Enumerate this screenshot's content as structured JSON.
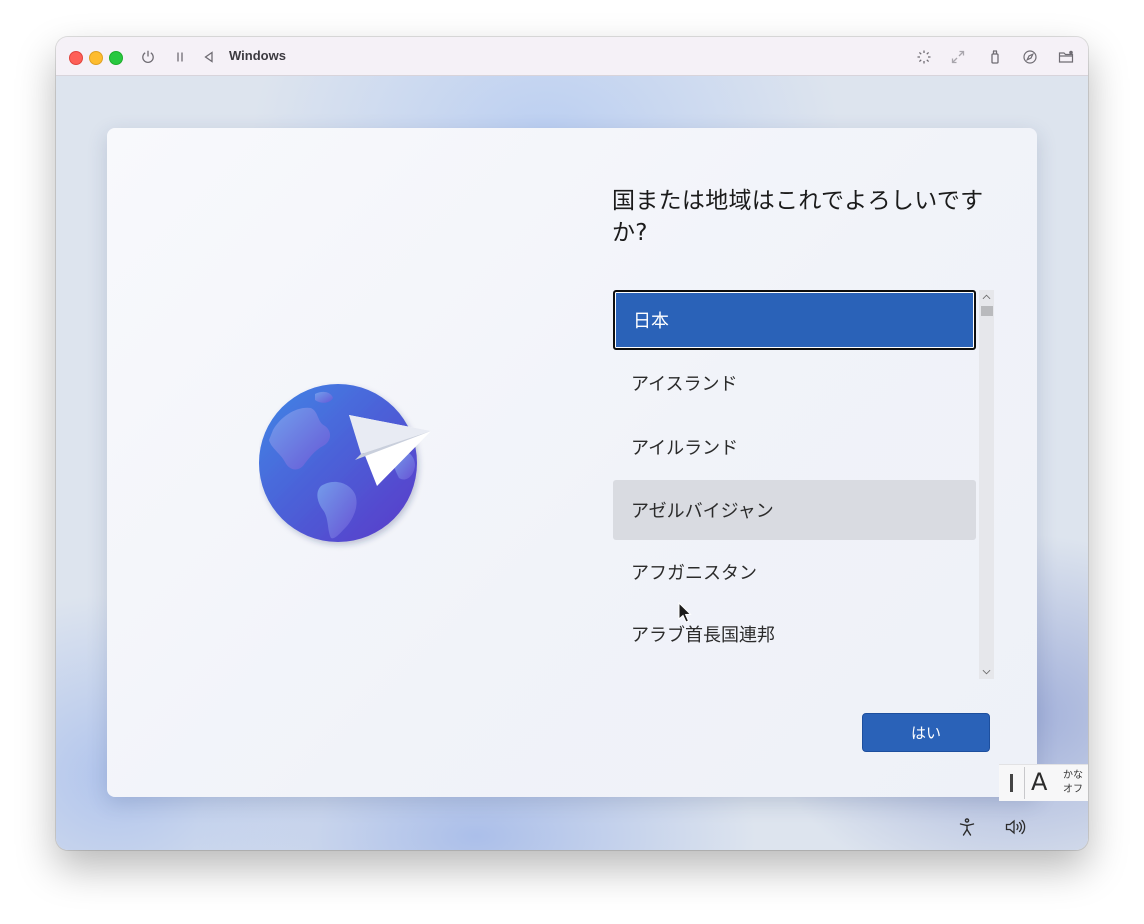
{
  "window": {
    "title": "Windows"
  },
  "titlebar_icons": {
    "left": [
      "power-icon",
      "pause-icon",
      "back-icon"
    ],
    "right": [
      "brightness-icon",
      "resize-icon",
      "usb-icon",
      "safari-icon",
      "folder-icon"
    ]
  },
  "oobe": {
    "heading": "国または地域はこれでよろしいですか?",
    "countries": [
      {
        "label": "日本",
        "state": "selected"
      },
      {
        "label": "アイスランド",
        "state": "normal"
      },
      {
        "label": "アイルランド",
        "state": "normal"
      },
      {
        "label": "アゼルバイジャン",
        "state": "hover"
      },
      {
        "label": "アフガニスタン",
        "state": "normal"
      },
      {
        "label": "アラブ首長国連邦",
        "state": "normal"
      }
    ],
    "yes_label": "はい"
  },
  "ime": {
    "mode": "A",
    "kana_line1": "かな",
    "kana_line2": "オフ"
  },
  "colors": {
    "accent": "#2a62b8",
    "hover": "#d9dbe1",
    "traffic_red": "#fe5f57",
    "traffic_yellow": "#febc2e",
    "traffic_green": "#28c840"
  }
}
